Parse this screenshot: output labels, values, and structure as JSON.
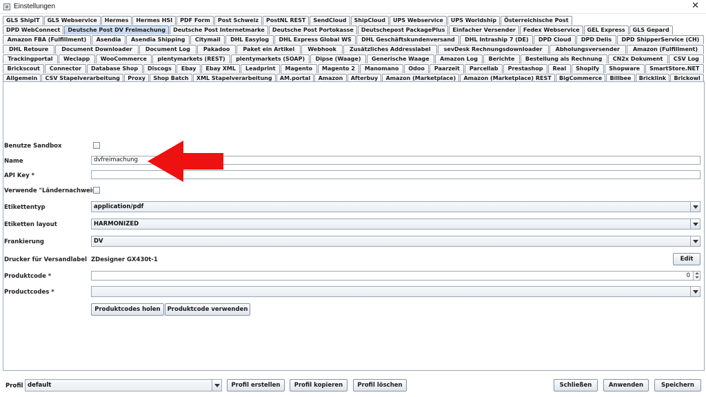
{
  "window": {
    "title": "Einstellungen",
    "close_glyph": "✕"
  },
  "tabs": {
    "row1": [
      "GLS ShipIT",
      "GLS Webservice",
      "Hermes",
      "Hermes HSI",
      "PDF Form",
      "Post Schweiz",
      "PostNL REST",
      "SendCloud",
      "ShipCloud",
      "UPS Webservice",
      "UPS Worldship",
      "Österreichische Post"
    ],
    "row2": [
      "DPD WebConnect",
      "Deutsche Post DV Freimachung",
      "Deutsche Post Internetmarke",
      "Deutsche Post Portokasse",
      "Deutschepost PackagePlus",
      "Einfacher Versender",
      "Fedex Webservice",
      "GEL Express",
      "GLS Gepard"
    ],
    "row3": [
      "Amazon FBA (Fulfillment)",
      "Asendia",
      "Asendia Shipping",
      "Citymail",
      "DHL Easylog",
      "DHL Express Global WS",
      "DHL Geschäftskundenversand",
      "DHL Intraship 7 (DE)",
      "DPD Cloud",
      "DPD Delis",
      "DPD ShipperService (CH)"
    ],
    "row4": [
      "DHL Retoure",
      "Document Downloader",
      "Document Log",
      "Pakadoo",
      "Paket ein Artikel",
      "Webhook",
      "Zusätzliches Addresslabel",
      "sevDesk Rechnungsdownloader",
      "Abholungsversender",
      "Amazon (Fulfillment)"
    ],
    "row5": [
      "Trackingportal",
      "Weclapp",
      "WooCommerce",
      "plentymarkets (REST)",
      "plentymarkets (SOAP)",
      "Dipse (Waage)",
      "Generische Waage",
      "Amazon Log",
      "Berichte",
      "Bestellung als Rechnung",
      "CN2x Dokument",
      "CSV Log"
    ],
    "row6": [
      "Brickscout",
      "Connector",
      "Database Shop",
      "Discogs",
      "Ebay",
      "Ebay XML",
      "Leadprint",
      "Magento",
      "Magento 2",
      "Manomano",
      "Odoo",
      "Paarzeit",
      "Parcellab",
      "Prestashop",
      "Real",
      "Shopify",
      "Shopware",
      "SmartStore.NET"
    ],
    "row7": [
      "Allgemein",
      "CSV Stapelverarbeitung",
      "Proxy",
      "Shop Batch",
      "XML Stapelverarbeitung",
      "AM.portal",
      "Amazon",
      "Afterbuy",
      "Amazon (Marketplace)",
      "Amazon (Marketplace) REST",
      "BigCommerce",
      "Billbee",
      "Bricklink",
      "Brickowl"
    ],
    "selected": "Deutsche Post DV Freimachung"
  },
  "form": {
    "sandbox_label": "Benutze Sandbox",
    "name_label": "Name",
    "name_value": "dvfreimachung",
    "apikey_label": "API Key *",
    "apikey_value": "",
    "laendernachweis_label": "Verwende \"Ländernachweis\"",
    "etikettentyp_label": "Etikettentyp",
    "etikettentyp_value": "application/pdf",
    "etikettenlayout_label": "Etiketten layout",
    "etikettenlayout_value": "HARMONIZED",
    "frankierung_label": "Frankierung",
    "frankierung_value": "DV",
    "drucker_label": "Drucker für Versandlabel",
    "drucker_value": "ZDesigner GX430t-1",
    "edit_button": "Edit",
    "produktcode_label": "Produktcode *",
    "produktcode_value": "0",
    "productcodes_label": "Productcodes *",
    "productcodes_value": "",
    "holen_button": "Produktcodes holen",
    "verwenden_button": "Produktcode verwenden"
  },
  "bottom": {
    "profil_label": "Profil",
    "profil_value": "default",
    "erstellen_button": "Profil erstellen",
    "kopieren_button": "Profil kopieren",
    "loeschen_button": "Profil löschen",
    "schliessen_button": "Schließen",
    "anwenden_button": "Anwenden",
    "speichern_button": "Speichern"
  },
  "colors": {
    "accent_selected_tab": "#c3d6ee",
    "annotation_arrow": "#ee1111"
  }
}
